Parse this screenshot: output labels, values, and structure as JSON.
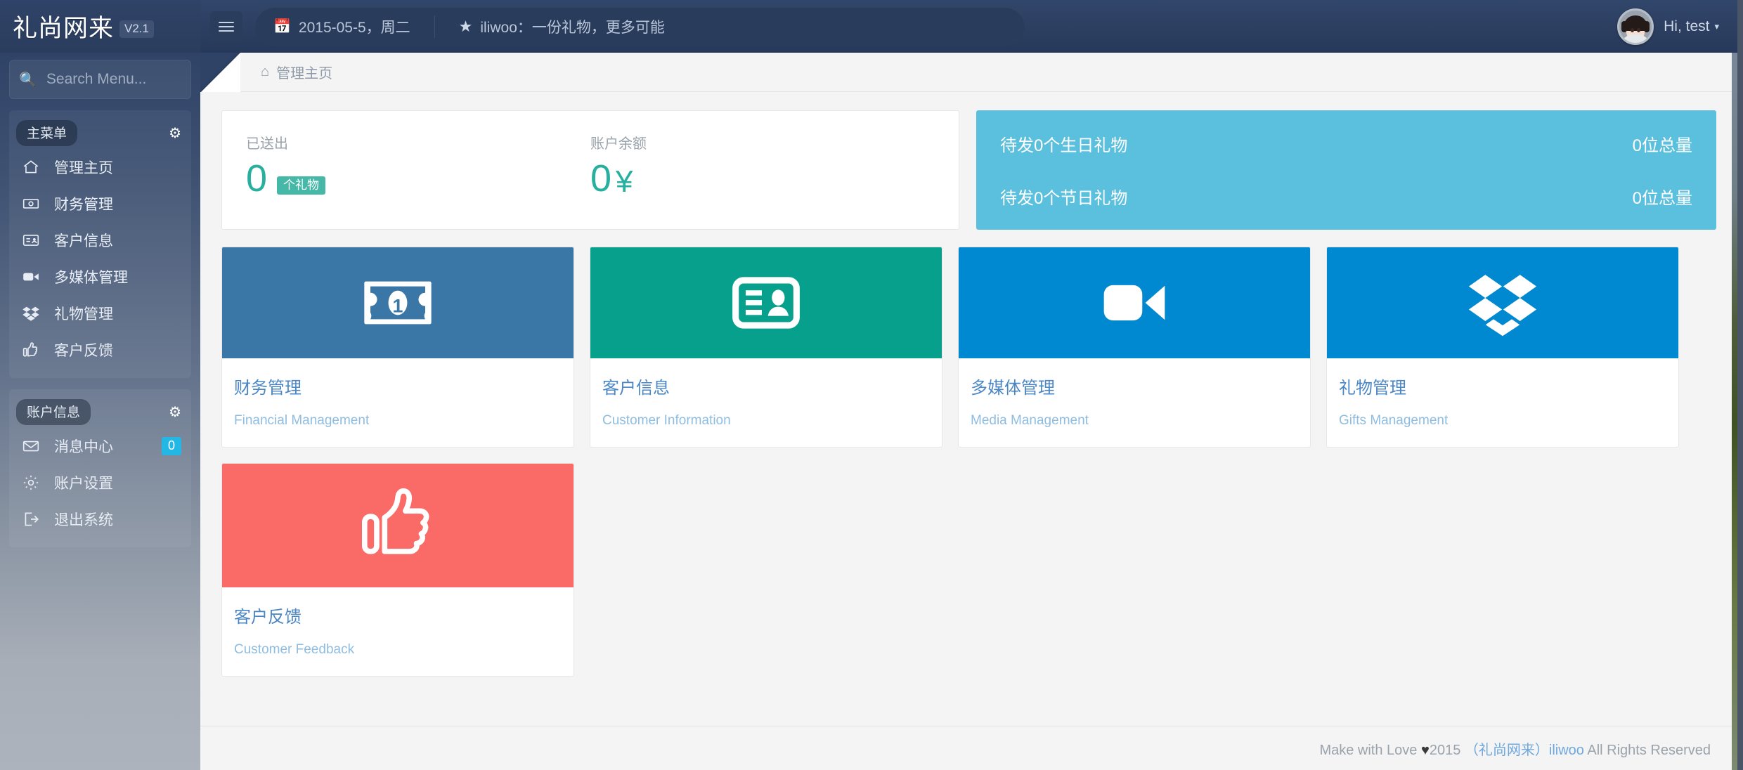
{
  "brand": {
    "title": "礼尚网来",
    "version": "V2.1"
  },
  "topbar": {
    "menu_toggle_icon": "hamburger-icon",
    "date_icon": "calendar-icon",
    "date_text": "2015-05-5，周二",
    "star_icon": "star-icon",
    "slogan": "iliwoo：一份礼物，更多可能",
    "user_label": "Hi, test",
    "user_caret": "▾"
  },
  "sidebar": {
    "search": {
      "icon": "search-menu-icon",
      "placeholder": "Search Menu...",
      "value": ""
    },
    "groups": [
      {
        "title": "主菜单",
        "gear_icon": "gear-icon",
        "items": [
          {
            "icon": "home-icon",
            "label": "管理主页",
            "badge": ""
          },
          {
            "icon": "money-icon",
            "label": "财务管理",
            "badge": ""
          },
          {
            "icon": "idcard-icon",
            "label": "客户信息",
            "badge": ""
          },
          {
            "icon": "video-icon",
            "label": "多媒体管理",
            "badge": ""
          },
          {
            "icon": "dropbox-icon",
            "label": "礼物管理",
            "badge": ""
          },
          {
            "icon": "thumbsup-icon",
            "label": "客户反馈",
            "badge": ""
          }
        ]
      },
      {
        "title": "账户信息",
        "gear_icon": "gear-icon",
        "items": [
          {
            "icon": "envelope-icon",
            "label": "消息中心",
            "badge": "0"
          },
          {
            "icon": "cog-icon",
            "label": "账户设置",
            "badge": ""
          },
          {
            "icon": "logout-icon",
            "label": "退出系统",
            "badge": ""
          }
        ]
      }
    ]
  },
  "breadcrumb": {
    "icon": "home-icon",
    "text": "管理主页"
  },
  "stats": [
    {
      "caption": "已送出",
      "value": "0",
      "badge": "个礼物",
      "unit": ""
    },
    {
      "caption": "账户余额",
      "value": "0",
      "badge": "",
      "unit": "¥"
    }
  ],
  "info_panel": {
    "bg_color": "#5bc0de",
    "rows": [
      {
        "left": "待发0个生日礼物",
        "right": "0位总量"
      },
      {
        "left": "待发0个节日礼物",
        "right": "0位总量"
      }
    ]
  },
  "tiles": [
    {
      "icon": "money-icon",
      "color": "#3a76a6",
      "title": "财务管理",
      "subtitle": "Financial Management"
    },
    {
      "icon": "idcard-icon",
      "color": "#07a08c",
      "title": "客户信息",
      "subtitle": "Customer Information"
    },
    {
      "icon": "video-icon",
      "color": "#0089d0",
      "title": "多媒体管理",
      "subtitle": "Media Management"
    },
    {
      "icon": "dropbox-icon",
      "color": "#0089d0",
      "title": "礼物管理",
      "subtitle": "Gifts Management"
    },
    {
      "icon": "thumbsup-icon",
      "color": "#fa6a67",
      "title": "客户反馈",
      "subtitle": "Customer Feedback"
    }
  ],
  "footer": {
    "prefix": "Make with Love ",
    "heart": "♥",
    "year": "2015",
    "link_cn": "（礼尚网来）",
    "link_en": "iliwoo",
    "suffix": " All Rights Reserved"
  }
}
